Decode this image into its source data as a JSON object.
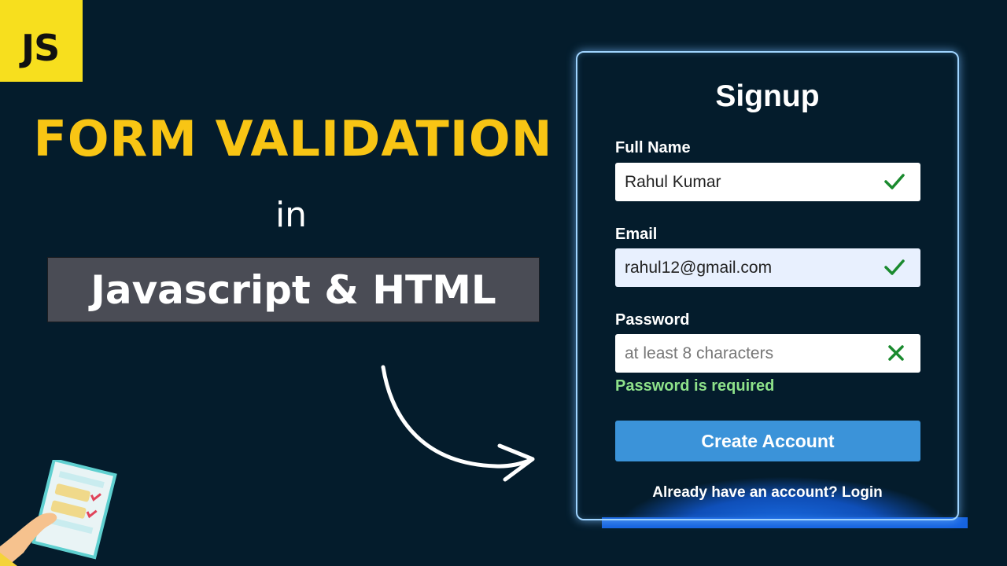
{
  "badge": {
    "text": "JS"
  },
  "headline": "FORM VALIDATION",
  "connector": "in",
  "tech": "Javascript & HTML",
  "form": {
    "title": "Signup",
    "full_name": {
      "label": "Full Name",
      "value": "Rahul Kumar",
      "status": "valid"
    },
    "email": {
      "label": "Email",
      "value": "rahul12@gmail.com",
      "status": "valid"
    },
    "password": {
      "label": "Password",
      "value": "",
      "placeholder": "at least 8 characters",
      "status": "invalid",
      "error": "Password is required"
    },
    "submit_label": "Create Account",
    "login_text": "Already have an account? Login"
  },
  "colors": {
    "background": "#041c2c",
    "headline": "#f8c514",
    "valid": "#1a8a2e",
    "invalid": "#1a8a2e",
    "error_text": "#8ee28a",
    "button": "#3b93d9",
    "card_border": "#9fd4ff"
  },
  "icons": {
    "valid": "check-icon",
    "invalid": "cross-icon",
    "arrow": "curved-arrow-icon",
    "illustration": "checklist-illustration-icon"
  }
}
